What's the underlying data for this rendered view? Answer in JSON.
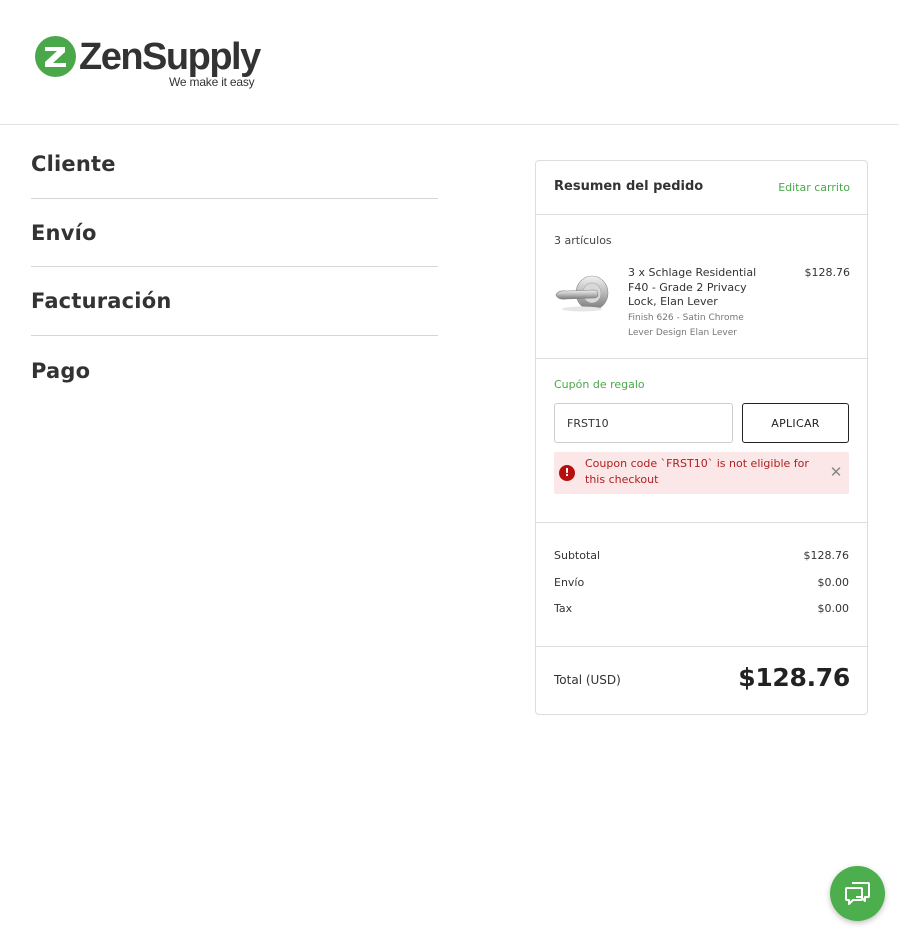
{
  "brand": {
    "name": "ZenSupply",
    "tagline": "We make it easy",
    "color_green": "#4aa84a",
    "icon": "zensupply-logo-icon"
  },
  "steps": [
    {
      "label": "Cliente"
    },
    {
      "label": "Envío"
    },
    {
      "label": "Facturación"
    },
    {
      "label": "Pago"
    }
  ],
  "summary": {
    "title": "Resumen del pedido",
    "edit_link": "Editar carrito",
    "items_count": "3 artículos",
    "items": [
      {
        "name": "3 x Schlage Residential F40 - Grade 2 Privacy Lock, Elan Lever",
        "options": [
          "Finish 626 - Satin Chrome",
          "Lever Design Elan Lever"
        ],
        "price": "$128.76",
        "icon": "lever-lock-icon"
      }
    ],
    "coupon": {
      "label": "Cupón de regalo",
      "value": "FRST10",
      "button": "APLICAR",
      "error": "Coupon code `FRST10` is not eligible for this checkout",
      "error_color": "#b02020"
    },
    "totals": [
      {
        "label": "Subtotal",
        "value": "$128.76"
      },
      {
        "label": "Envío",
        "value": "$0.00"
      },
      {
        "label": "Tax",
        "value": "$0.00"
      }
    ],
    "total_label": "Total (USD)",
    "total_value": "$128.76"
  },
  "chat": {
    "icon": "chat-bubble-icon",
    "color": "#4cae4c"
  }
}
